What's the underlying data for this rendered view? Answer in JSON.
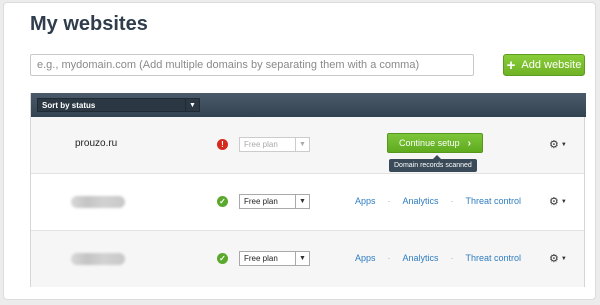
{
  "page": {
    "title": "My websites"
  },
  "add_form": {
    "placeholder": "e.g., mydomain.com (Add multiple domains by separating them with a comma)",
    "button_label": "Add website",
    "button_icon": "plus-icon"
  },
  "table": {
    "sort_label": "Sort by status",
    "rows": [
      {
        "domain": "prouzo.ru",
        "status_icon": "warning-icon",
        "plan": "Free plan",
        "plan_disabled": true,
        "action_label": "Continue setup",
        "tooltip": "Domain records scanned"
      },
      {
        "domain": "",
        "domain_blurred": true,
        "status_icon": "check-icon",
        "plan": "Free plan",
        "links": [
          "Apps",
          "Analytics",
          "Threat control"
        ]
      },
      {
        "domain": "",
        "domain_blurred": true,
        "status_icon": "check-icon",
        "plan": "Free plan",
        "links": [
          "Apps",
          "Analytics",
          "Threat control"
        ]
      }
    ]
  },
  "colors": {
    "accent_green": "#6fb224",
    "header_bg": "#3e4e5d",
    "link_blue": "#2f7dc0",
    "warn_red": "#d52b1e",
    "ok_green": "#5aa82c"
  }
}
